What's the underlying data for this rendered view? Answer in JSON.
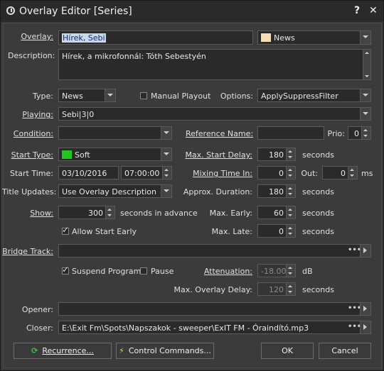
{
  "window": {
    "title": "Overlay Editor [Series]",
    "help_btn": "?",
    "close_btn": "✕"
  },
  "colors": {
    "news_swatch": "#f5deb3",
    "soft_swatch": "#22c422"
  },
  "labels": {
    "overlay": "Overlay:",
    "description": "Description:",
    "type": "Type:",
    "manual_playout": "Manual Playout",
    "options": "Options:",
    "playing": "Playing:",
    "condition": "Condition:",
    "reference_name": "Reference Name:",
    "prio": "Prio:",
    "start_type": "Start Type:",
    "max_start_delay": "Max. Start Delay:",
    "seconds": "seconds",
    "start_time": "Start Time:",
    "mixing_time_in": "Mixing Time In:",
    "out": "Out:",
    "ms": "ms",
    "title_updates": "Title Updates:",
    "approx_duration": "Approx. Duration:",
    "show": "Show:",
    "seconds_in_advance": "seconds in advance",
    "max_early": "Max. Early:",
    "allow_start_early": "Allow Start Early",
    "max_late": "Max. Late:",
    "bridge_track": "Bridge Track:",
    "suspend_program": "Suspend Program",
    "pause": "Pause",
    "attenuation": "Attenuation:",
    "db": "dB",
    "max_overlay_delay": "Max. Overlay Delay:",
    "opener": "Opener:",
    "closer": "Closer:"
  },
  "values": {
    "overlay": "Hírek, Sebi",
    "overlay_category": "News",
    "description": "Hírek, a mikrofonnál: Tóth Sebestyén",
    "type": "News",
    "options": "ApplySuppressFilter",
    "playing": "Sebi|3|0",
    "condition": "",
    "reference_name": "",
    "prio": "0",
    "start_type": "Soft",
    "max_start_delay": "180",
    "start_date": "03/10/2016",
    "start_clock": "07:00:00",
    "mixing_in": "0",
    "mixing_out": "0",
    "title_updates": "Use Overlay Description",
    "approx_duration": "180",
    "show": "300",
    "max_early": "60",
    "max_late": "0",
    "bridge_track": "",
    "attenuation": "-18.00",
    "max_overlay_delay": "120",
    "opener": "",
    "closer": "E:\\Exit Fm\\Spots\\Napszakok - sweeper\\ExIT FM - Óraindító.mp3",
    "manual_playout": false,
    "allow_start_early": true,
    "suspend_program": true,
    "pause": false
  },
  "buttons": {
    "recurrence": "Recurrence...",
    "control_commands": "Control Commands...",
    "ok": "OK",
    "cancel": "Cancel"
  }
}
